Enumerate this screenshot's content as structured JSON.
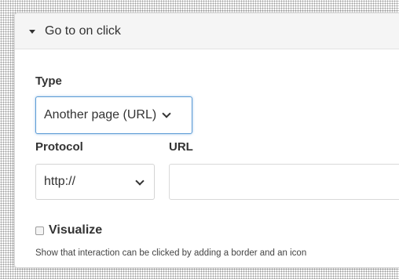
{
  "section": {
    "title": "Go to on click"
  },
  "type_field": {
    "label": "Type",
    "selected": "Another page (URL)"
  },
  "protocol_field": {
    "label": "Protocol",
    "selected": "http://"
  },
  "url_field": {
    "label": "URL",
    "value": "",
    "placeholder": ""
  },
  "visualize": {
    "label": "Visualize",
    "checked": false,
    "help_text": "Show that interaction can be clicked by adding a border and an icon"
  },
  "colors": {
    "focus_border": "#5b9bd5",
    "header_bg": "#f5f5f5",
    "text": "#333333"
  },
  "icons": {
    "section_toggle": "caret-down-icon",
    "select_arrow": "chevron-down-icon"
  }
}
